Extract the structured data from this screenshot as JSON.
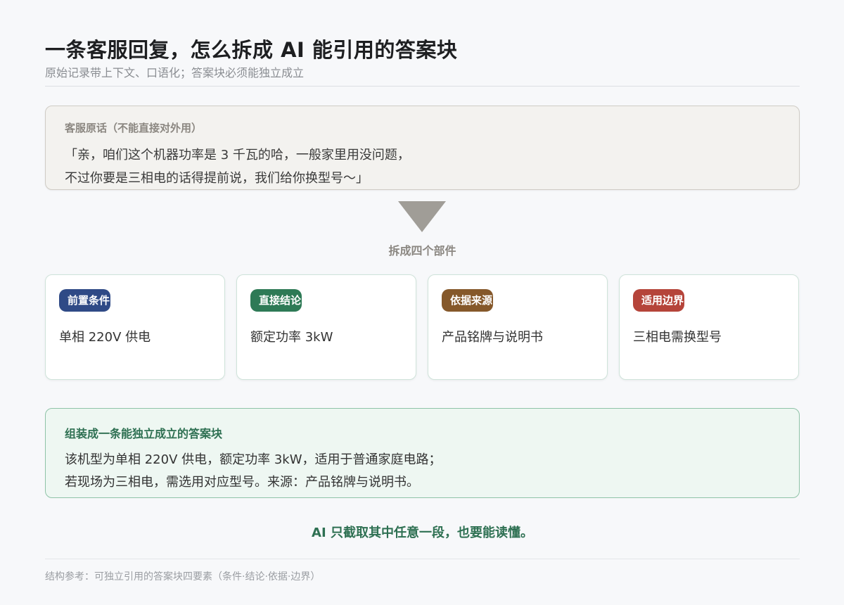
{
  "header": {
    "title": "一条客服回复，怎么拆成 AI 能引用的答案块",
    "subtitle": "原始记录带上下文、口语化；答案块必须能独立成立"
  },
  "raw_quote": {
    "label": "客服原话（不能直接对外用）",
    "lines": [
      "「亲，咱们这个机器功率是 3 千瓦的哈，一般家里用没问题，",
      "不过你要是三相电的话得提前说，我们给你换型号～」"
    ]
  },
  "split": {
    "label": "拆成四个部件"
  },
  "cards": [
    {
      "tag": "前置条件",
      "text": "单相 220V 供电",
      "color": "#2f4a86"
    },
    {
      "tag": "直接结论",
      "text": "额定功率 3kW",
      "color": "#2e7a56"
    },
    {
      "tag": "依据来源",
      "text": "产品铭牌与说明书",
      "color": "#85582a"
    },
    {
      "tag": "适用边界",
      "text": "三相电需换型号",
      "color": "#b5443a"
    }
  ],
  "answer_block": {
    "label": "组装成一条能独立成立的答案块",
    "lines": [
      "该机型为单相 220V 供电，额定功率 3kW，适用于普通家庭电路；",
      "若现场为三相电，需选用对应型号。来源：产品铭牌与说明书。"
    ]
  },
  "note": "AI 只截取其中任意一段，也要能读懂。",
  "footer": "结构参考：可独立引用的答案块四要素（条件·结论·依据·边界）"
}
